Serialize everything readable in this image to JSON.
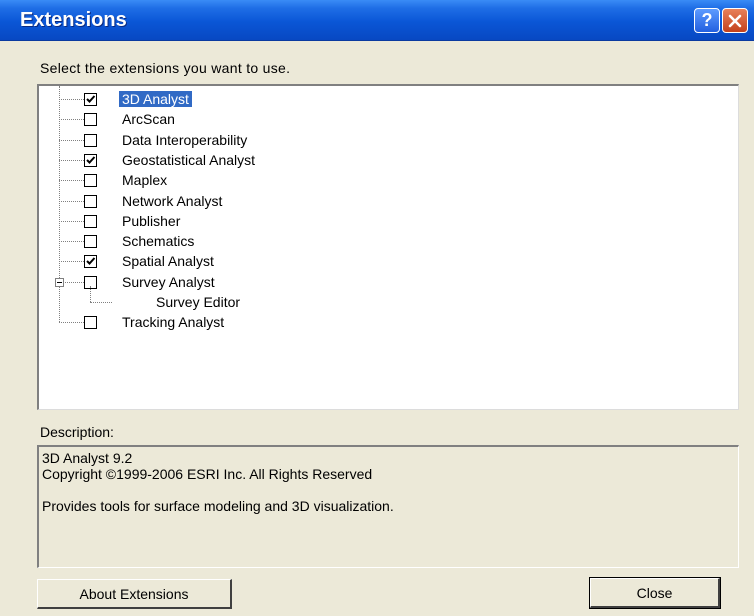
{
  "window": {
    "title": "Extensions",
    "help_label": "?"
  },
  "prompt": "Select the extensions you want to use.",
  "extensions": [
    {
      "label": "3D Analyst",
      "checked": true,
      "selected": true
    },
    {
      "label": "ArcScan",
      "checked": false
    },
    {
      "label": "Data Interoperability",
      "checked": false
    },
    {
      "label": "Geostatistical Analyst",
      "checked": true
    },
    {
      "label": "Maplex",
      "checked": false
    },
    {
      "label": "Network Analyst",
      "checked": false
    },
    {
      "label": "Publisher",
      "checked": false
    },
    {
      "label": "Schematics",
      "checked": false
    },
    {
      "label": "Spatial Analyst",
      "checked": true
    },
    {
      "label": "Survey Analyst",
      "checked": false,
      "expanded": true,
      "children": [
        {
          "label": "Survey Editor"
        }
      ]
    },
    {
      "label": "Tracking Analyst",
      "checked": false
    }
  ],
  "description": {
    "label": "Description:",
    "lines": [
      "3D Analyst 9.2",
      "Copyright ©1999-2006 ESRI Inc. All Rights Reserved",
      "",
      "Provides tools for surface modeling and 3D visualization."
    ]
  },
  "buttons": {
    "about": "About Extensions",
    "close": "Close"
  }
}
